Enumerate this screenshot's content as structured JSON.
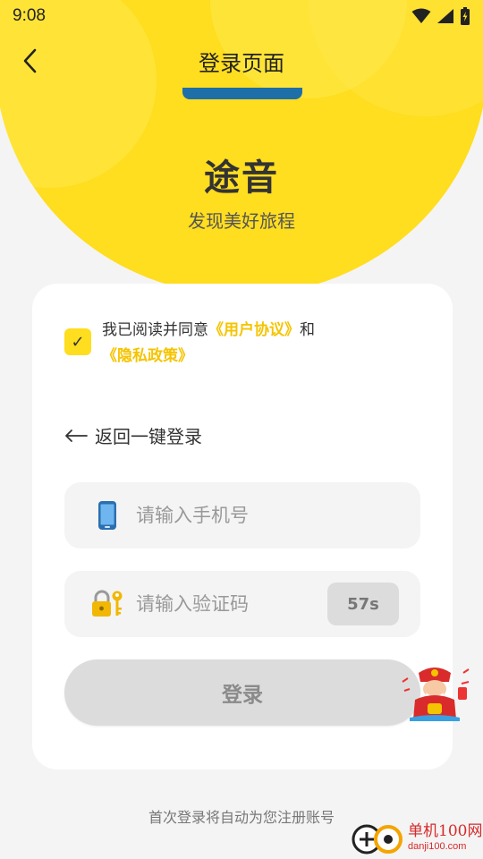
{
  "status_bar": {
    "time": "9:08"
  },
  "header": {
    "title": "登录页面"
  },
  "brand": {
    "name": "途音",
    "slogan": "发现美好旅程"
  },
  "agreement": {
    "checked": true,
    "check_mark": "✓",
    "prefix": "我已阅读并同意",
    "user_agreement": "《用户协议》",
    "conjunction": "和",
    "privacy_policy": "《隐私政策》"
  },
  "back_link": {
    "label": "返回一键登录"
  },
  "phone_field": {
    "placeholder": "请输入手机号",
    "value": ""
  },
  "code_field": {
    "placeholder": "请输入验证码",
    "value": "",
    "countdown": "57s"
  },
  "login_button": {
    "label": "登录"
  },
  "footer": {
    "note": "首次登录将自动为您注册账号"
  },
  "watermark": {
    "cn": "单机100网",
    "en": "danji100.com"
  },
  "colors": {
    "accent": "#ffdd1f",
    "link": "#f5c400",
    "button_disabled": "#dcdcdc"
  }
}
